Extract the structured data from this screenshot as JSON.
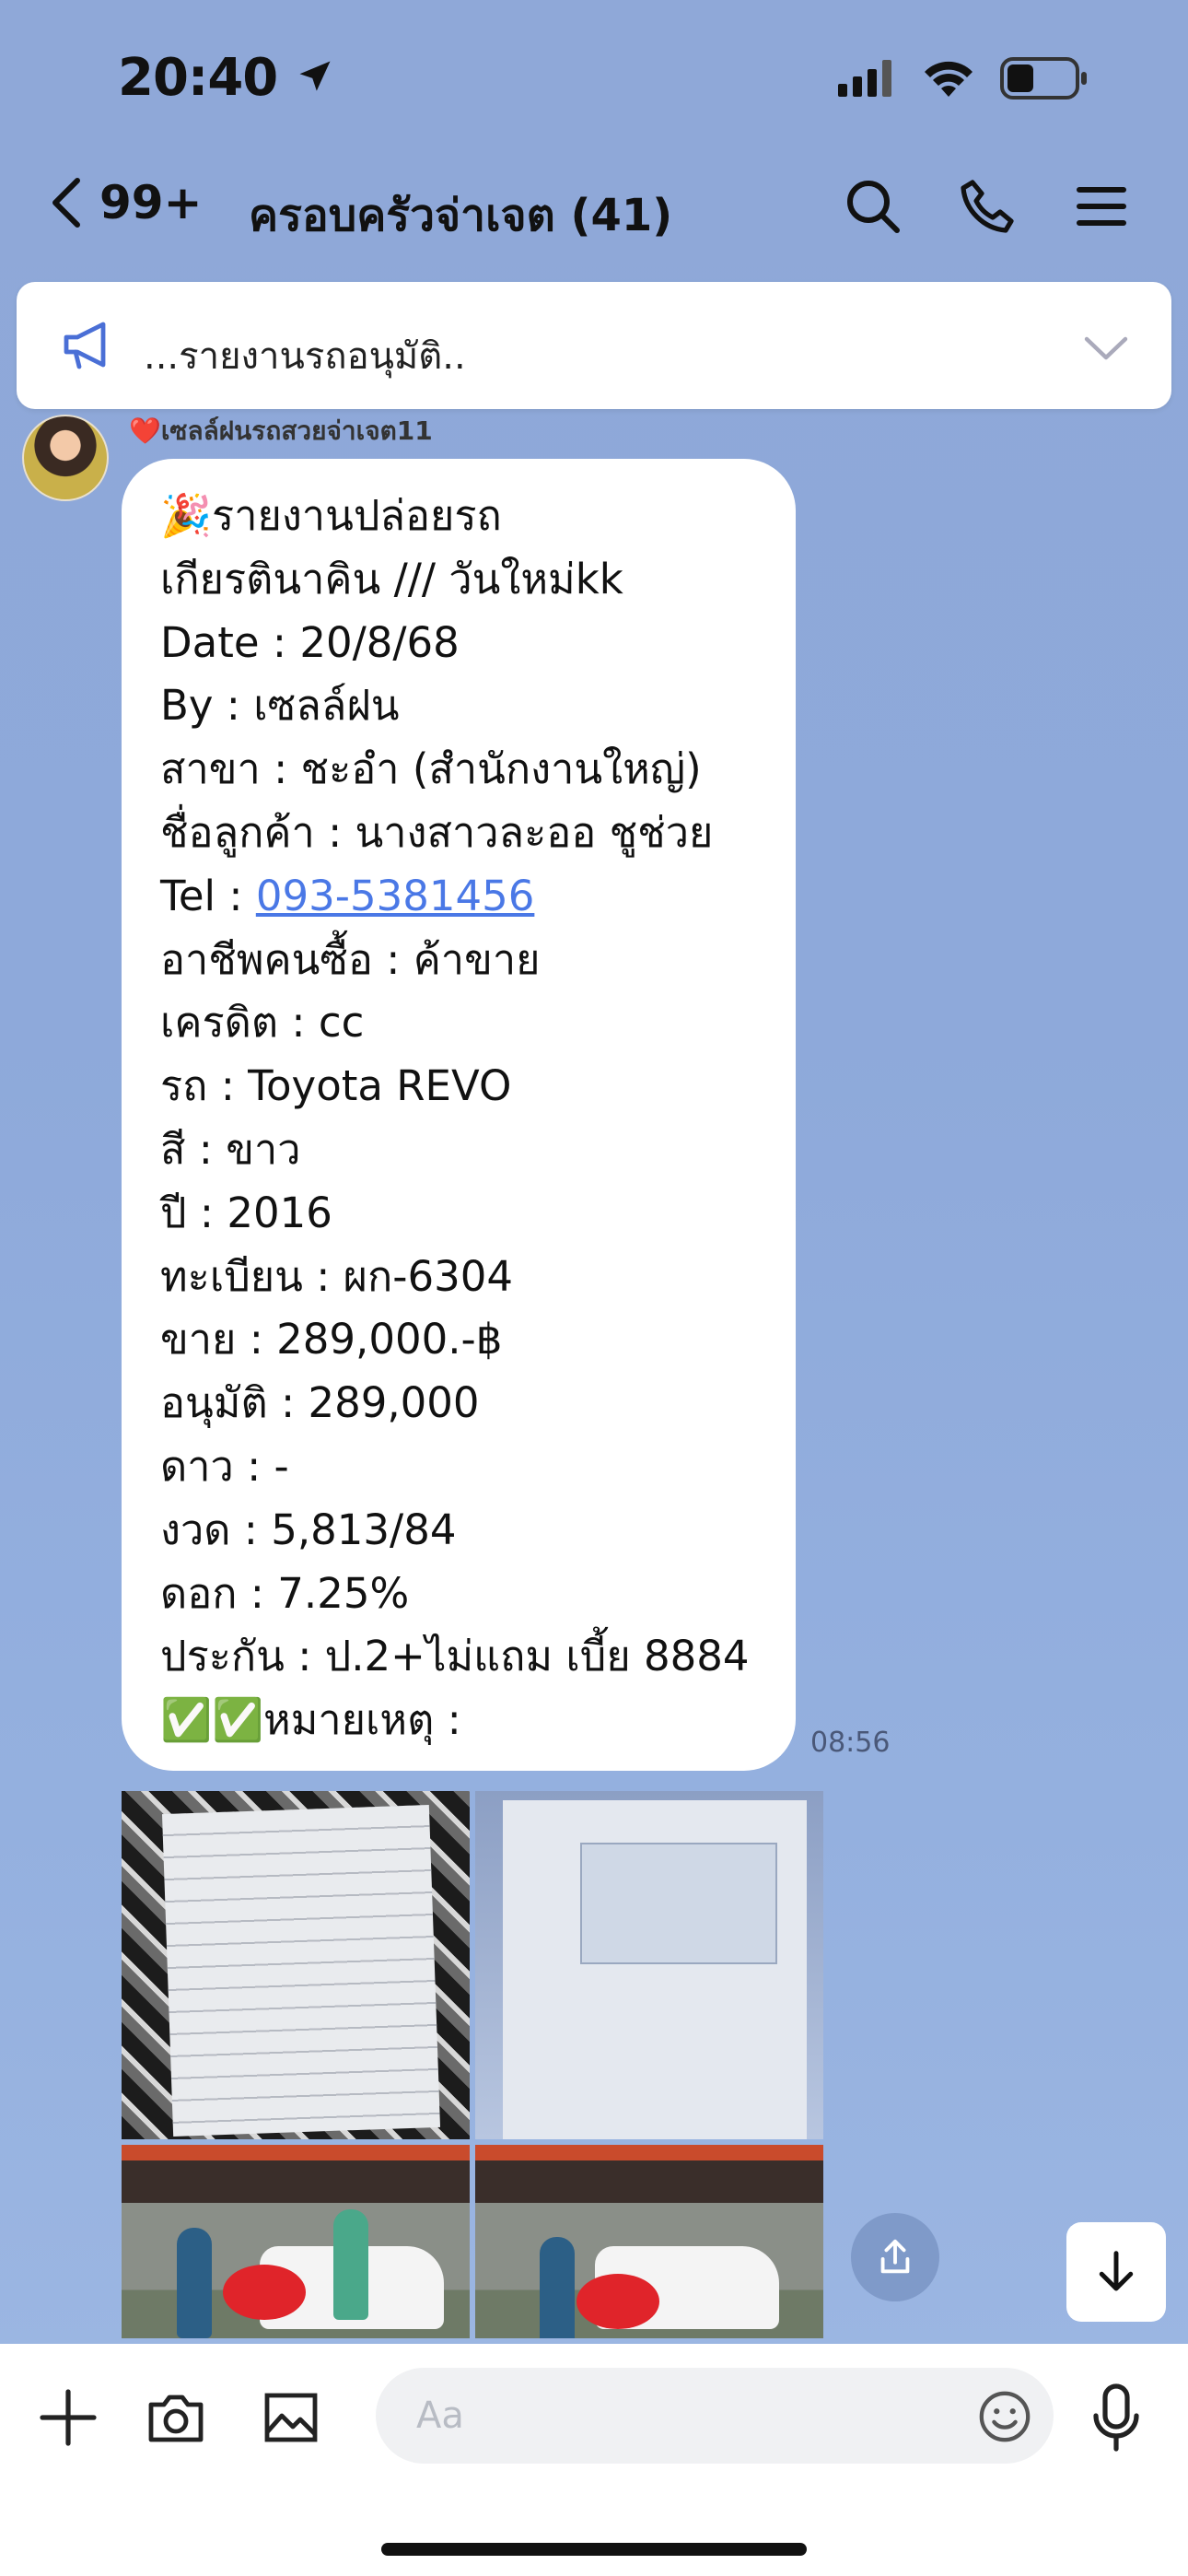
{
  "status_bar": {
    "time": "20:40"
  },
  "header": {
    "back_count": "99+",
    "title": "ครอบครัวจ่าเจต (41)"
  },
  "announcement": {
    "text": "...รายงานรถอนุมัติ.."
  },
  "message": {
    "sender": "❤️เซลล์ฝนรถสวยจ่าเจต11",
    "time": "08:56",
    "lines": [
      "🎉รายงานปล่อยรถ",
      "เกียรตินาคิน /// วันใหม่kk",
      "Date : 20/8/68",
      "By : เซลล์ฝน",
      "สาขา : ชะอำ (สำนักงานใหญ่)",
      "ชื่อลูกค้า : นางสาวละออ ชูช่วย",
      "Tel : ",
      "อาชีพคนซื้อ : ค้าขาย",
      "เครดิต : cc",
      "รถ : Toyota REVO",
      "สี : ขาว",
      "ปี : 2016",
      "ทะเบียน : ผก-6304",
      "ขาย : 289,000.-฿",
      "อนุมัติ : 289,000",
      "ดาว : -",
      "งวด : 5,813/84",
      "ดอก : 7.25%",
      "ประกัน : ป.2+ไม่แถม เบี้ย 8884",
      "✅✅หมายเหตุ :"
    ],
    "phone_link": "093-5381456"
  },
  "composer": {
    "placeholder": "Aa"
  },
  "icons": {
    "location": "location-arrow-icon",
    "signal": "signal-icon",
    "wifi": "wifi-icon",
    "battery": "battery-icon",
    "back": "chevron-left-icon",
    "search": "search-icon",
    "call": "phone-icon",
    "menu": "menu-icon",
    "announce": "megaphone-icon",
    "expand": "chevron-down-icon",
    "share": "share-icon",
    "scroll_down": "arrow-down-icon",
    "add": "plus-icon",
    "camera": "camera-icon",
    "gallery": "image-icon",
    "emoji": "emoji-icon",
    "mic": "microphone-icon"
  },
  "colors": {
    "background": "#8fa8d8",
    "bubble": "#ffffff",
    "link": "#4a78e6"
  }
}
